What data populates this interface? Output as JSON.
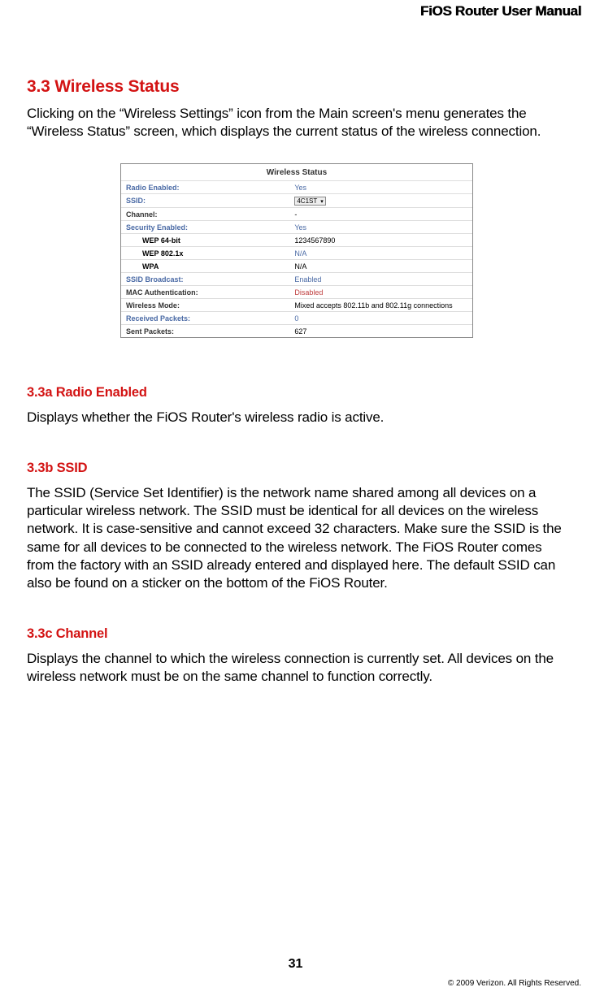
{
  "header": {
    "title": "FiOS Router User Manual"
  },
  "section_3_3": {
    "heading": "3.3  Wireless Status",
    "body": "Clicking on the “Wireless Settings” icon from the Main screen's menu generates the “Wireless Status” screen, which displays the current status of the wireless connection."
  },
  "screenshot": {
    "title": "Wireless Status",
    "rows": [
      {
        "label": "Radio Enabled:",
        "value": "Yes",
        "labelClass": "blue-label",
        "valClass": "val-blue"
      },
      {
        "label": "SSID:",
        "value": "4C1ST",
        "labelClass": "blue-label",
        "valClass": "",
        "select": true
      },
      {
        "label": "Channel:",
        "value": "-",
        "labelClass": "",
        "valClass": ""
      },
      {
        "label": "Security Enabled:",
        "value": "Yes",
        "labelClass": "blue-label",
        "valClass": "val-blue"
      },
      {
        "label": "WEP 64-bit",
        "value": "1234567890",
        "labelClass": "indent",
        "valClass": ""
      },
      {
        "label": "WEP 802.1x",
        "value": "N/A",
        "labelClass": "indent blue-label",
        "valClass": "val-blue"
      },
      {
        "label": "WPA",
        "value": "N/A",
        "labelClass": "indent",
        "valClass": ""
      },
      {
        "label": "SSID Broadcast:",
        "value": "Enabled",
        "labelClass": "blue-label",
        "valClass": "val-blue"
      },
      {
        "label": "MAC Authentication:",
        "value": "Disabled",
        "labelClass": "",
        "valClass": "val-red"
      },
      {
        "label": "Wireless Mode:",
        "value": "Mixed accepts 802.11b and 802.11g connections",
        "labelClass": "",
        "valClass": ""
      },
      {
        "label": "Received Packets:",
        "value": "0",
        "labelClass": "blue-label",
        "valClass": "val-blue"
      },
      {
        "label": "Sent Packets:",
        "value": "627",
        "labelClass": "",
        "valClass": ""
      }
    ]
  },
  "section_3_3a": {
    "heading": "3.3a  Radio Enabled",
    "body": "Displays whether the FiOS Router's wireless radio is active."
  },
  "section_3_3b": {
    "heading": "3.3b  SSID",
    "body": "The SSID (Service Set Identifier) is the network name shared among all devices on a particular wireless network. The SSID must be identical for all devices on the wireless network. It is case-sensitive and cannot exceed 32 characters. Make sure the SSID is the same for all devices to be connected to the wireless network. The FiOS Router comes from the factory with an SSID already entered and displayed here. The default SSID can also be found on a sticker on the bottom of the FiOS Router."
  },
  "section_3_3c": {
    "heading": "3.3c  Channel",
    "body": "Displays the channel to which the wireless connection is currently set. All devices on the wireless network must be on the same channel to function correctly."
  },
  "footer": {
    "page": "31",
    "copyright": "© 2009 Verizon. All Rights Reserved."
  }
}
